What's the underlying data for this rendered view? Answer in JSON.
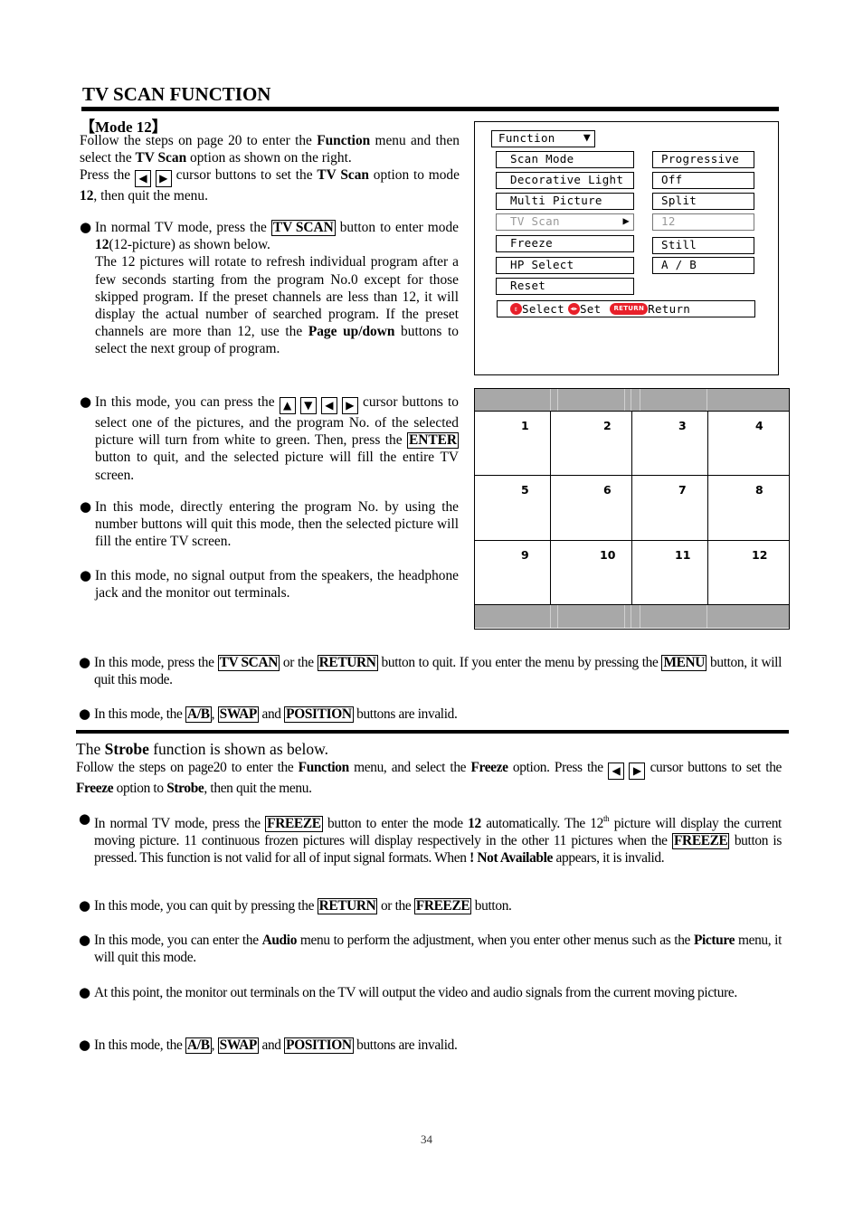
{
  "title": "TV SCAN FUNCTION",
  "mode_heading": "【Mode 12】",
  "intro": {
    "t1": "Follow the steps on page 20 to enter the ",
    "b1": "Function",
    "t2": " menu and then select the ",
    "b2": "TV Scan",
    "t3": " option as shown on the right.",
    "t4": "Press the ",
    "t5": " cursor buttons to set the ",
    "b3": "TV Scan",
    "t6": " option to mode ",
    "b4": "12",
    "t7": ", then quit the menu."
  },
  "icons": {
    "bullet": "●",
    "left_arrow": "◀",
    "right_arrow": "▶",
    "up_arrow": "▲",
    "down_arrow": "▼"
  },
  "bullets_left": [
    {
      "t1": "In normal TV mode, press the ",
      "k1": "TV SCAN",
      "t2": " button to enter mode ",
      "b1": "12",
      "t3": "(12-picture) as shown below.",
      "t4": "The 12 pictures will rotate to refresh individual program after a few seconds starting from the program No.0 except for those skipped program. If the preset channels are less than 12, it will display the actual number of searched program. If the preset channels are more than 12, use the ",
      "b2": "Page up/down",
      "t5": " buttons to select the next group of program."
    },
    {
      "t1": "In this mode, you can press the ",
      "t2": " cursor buttons to select one of the pictures, and the program No. of the selected picture will turn from white to green. Then, press the ",
      "k1": "ENTER",
      "t3": " button to quit, and the selected picture will fill the entire TV screen."
    },
    {
      "t1": "In this mode, directly entering the program No. by using the number buttons will quit this mode, then the selected picture will fill the entire TV screen."
    },
    {
      "t1": "In this mode, no signal output from the speakers, the headphone jack and the monitor out terminals."
    }
  ],
  "menu": {
    "title": "Function",
    "title_icon": "▼",
    "items": [
      {
        "label": "Scan Mode",
        "value": "Progressive",
        "dim": false
      },
      {
        "label": "Decorative Light",
        "value": "Off",
        "dim": false
      },
      {
        "label": "Multi Picture",
        "value": "Split",
        "dim": false
      },
      {
        "label": "TV Scan",
        "value": "12",
        "dim": true
      },
      {
        "label": "Freeze",
        "value": "Still",
        "dim": false
      },
      {
        "label": "HP Select",
        "value": "A / B",
        "dim": false
      },
      {
        "label": "Reset",
        "value": null,
        "dim": false
      }
    ],
    "selected_arrow": "▶",
    "hint": {
      "select_icon": "⇕",
      "select_label": "Select",
      "set_icon": "◀▶",
      "set_label": "Set",
      "return_icon": "RETURN",
      "return_label": "Return",
      "accent_color": "#e8202a"
    }
  },
  "grid": {
    "band_color": "#a8a8a8",
    "cells": [
      "1",
      "2",
      "3",
      "4",
      "5",
      "6",
      "7",
      "8",
      "9",
      "10",
      "11",
      "12"
    ]
  },
  "bullets_full": [
    {
      "t1": "In this mode, press the ",
      "k1": "TV SCAN",
      "t2": " or the ",
      "k2": "RETURN",
      "t3": " button to quit. If you enter the menu by pressing the ",
      "k3": "MENU",
      "t4": " button, it will quit this mode."
    },
    {
      "t1": "In this mode, the ",
      "k1": "A/B",
      "t2": ", ",
      "k2": "SWAP",
      "t3": " and ",
      "k3": "POSITION",
      "t4": " buttons are invalid."
    }
  ],
  "strobe": {
    "heading_t1": "The ",
    "heading_b": "Strobe",
    "heading_t2": " function is shown as below.",
    "intro_t1": "Follow the steps on page20 to enter the ",
    "intro_b1": "Function",
    "intro_t2": " menu, and select the ",
    "intro_b2": "Freeze",
    "intro_t3": " option. Press the ",
    "intro_t4": " cursor buttons to set the ",
    "intro_b3": "Freeze",
    "intro_t5": " option to ",
    "intro_b4": "Strobe",
    "intro_t6": ", then quit the menu.",
    "bullets": [
      {
        "t1": "In normal TV mode, press the ",
        "k1": "FREEZE",
        "t2": " button to enter the mode ",
        "b1": "12",
        "t3": " automatically. The 12",
        "sup": "th",
        "t4": " picture will display the current moving picture. 11 continuous frozen pictures will display respectively in the other 11 pictures when the ",
        "k2": "FREEZE",
        "t5": " button is pressed. This function is not valid for all of input signal formats.  When ",
        "b2": "! Not Available",
        "t6": " appears, it is invalid."
      },
      {
        "t1": "In this mode, you can quit by pressing the ",
        "k1": "RETURN",
        "t2": " or the ",
        "k2": "FREEZE",
        "t3": " button."
      },
      {
        "t1": "In this mode, you can enter the ",
        "b1": "Audio",
        "t2": " menu to perform the adjustment, when you enter other menus such as the ",
        "b2": "Picture",
        "t3": " menu, it will quit this mode."
      },
      {
        "t1": "At this point, the monitor out terminals on the TV will output the video and audio signals from the current moving picture."
      },
      {
        "t1": "In this mode, the ",
        "k1": "A/B",
        "t2": ", ",
        "k2": "SWAP",
        "t3": " and ",
        "k3": "POSITION",
        "t4": " buttons are invalid."
      }
    ]
  },
  "page_number": "34"
}
